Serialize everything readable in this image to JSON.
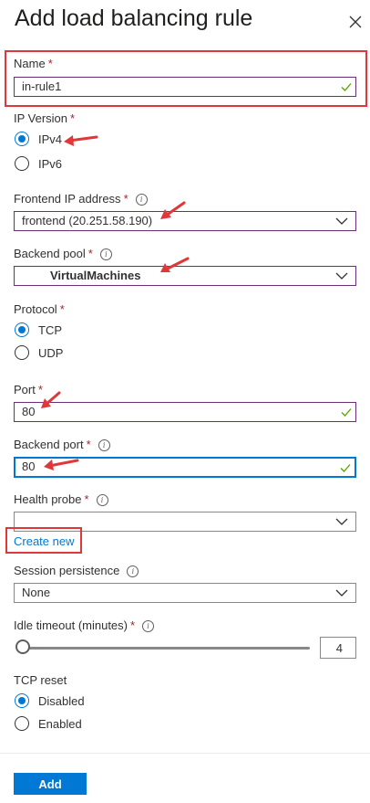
{
  "panel": {
    "title": "Add load balancing rule"
  },
  "name": {
    "label": "Name",
    "required": "*",
    "value": "in-rule1"
  },
  "ip_version": {
    "label": "IP Version",
    "required": "*",
    "options": [
      "IPv4",
      "IPv6"
    ],
    "selected": "IPv4"
  },
  "frontend_ip": {
    "label": "Frontend IP address",
    "required": "*",
    "value": "frontend (20.251.58.190)"
  },
  "backend_pool": {
    "label": "Backend pool",
    "required": "*",
    "value": "VirtualMachines"
  },
  "protocol": {
    "label": "Protocol",
    "required": "*",
    "options": [
      "TCP",
      "UDP"
    ],
    "selected": "TCP"
  },
  "port": {
    "label": "Port",
    "required": "*",
    "value": "80"
  },
  "backend_port": {
    "label": "Backend port",
    "required": "*",
    "value": "80"
  },
  "health_probe": {
    "label": "Health probe",
    "required": "*",
    "value": "",
    "create_new": "Create new"
  },
  "session_persistence": {
    "label": "Session persistence",
    "value": "None"
  },
  "idle_timeout": {
    "label": "Idle timeout (minutes)",
    "required": "*",
    "value": "4",
    "min": 4,
    "max": 30
  },
  "tcp_reset": {
    "label": "TCP reset",
    "options": [
      "Disabled",
      "Enabled"
    ],
    "selected": "Disabled"
  },
  "footer": {
    "add_label": "Add"
  },
  "colors": {
    "accent": "#0078d4",
    "annotation": "#e0383a",
    "highlight_border": "#6b2f7a",
    "required": "#a4262c"
  }
}
